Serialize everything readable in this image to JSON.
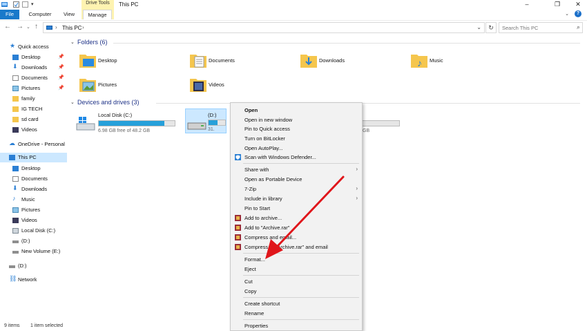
{
  "window": {
    "title": "This PC",
    "context_tab_group": "Drive Tools",
    "tabs": {
      "file": "File",
      "computer": "Computer",
      "view": "View",
      "manage": "Manage"
    },
    "controls": {
      "minimize": "–",
      "maximize": "❐",
      "close": "✕"
    }
  },
  "address": {
    "path_label": "This PC",
    "search_placeholder": "Search This PC"
  },
  "navpane": {
    "quick_access": "Quick access",
    "quick_items": [
      "Desktop",
      "Downloads",
      "Documents",
      "Pictures",
      "family",
      "IG TECH",
      "sd card",
      "Videos"
    ],
    "onedrive": "OneDrive - Personal",
    "this_pc": "This PC",
    "pc_items": [
      "Desktop",
      "Documents",
      "Downloads",
      "Music",
      "Pictures",
      "Videos",
      "Local Disk (C:)",
      "(D:)",
      "New Volume (E:)"
    ],
    "removable": "(D:)",
    "network": "Network"
  },
  "folders_group": {
    "title": "Folders (6)",
    "items": [
      "Desktop",
      "Documents",
      "Downloads",
      "Music",
      "Pictures",
      "Videos"
    ]
  },
  "drives_group": {
    "title": "Devices and drives (3)",
    "drives": [
      {
        "name": "Local Disk (C:)",
        "free": "6.98 GB free of 48.2 GB",
        "used_fraction": 0.86
      },
      {
        "name": "(D:)",
        "free": "31.",
        "used_fraction": 0.55
      },
      {
        "name": "",
        "free": "GB",
        "used_fraction": 0.0
      }
    ]
  },
  "context_menu": {
    "items": [
      "Open",
      "Open in new window",
      "Pin to Quick access",
      "Turn on BitLocker",
      "Open AutoPlay...",
      "Scan with Windows Defender...",
      "Share with",
      "Open as Portable Device",
      "7-Zip",
      "Include in library",
      "Pin to Start",
      "Add to archive...",
      "Add to \"Archive.rar\"",
      "Compress and email...",
      "Compress to \"Archive.rar\" and email",
      "Format...",
      "Eject",
      "Cut",
      "Copy",
      "Create shortcut",
      "Rename",
      "Properties"
    ]
  },
  "status": {
    "count": "9 items",
    "selected": "1 item selected"
  },
  "colors": {
    "accent": "#1979ca",
    "arrow": "#e0161b",
    "drive_bar": "#26a0da",
    "selection": "#cce8ff"
  }
}
